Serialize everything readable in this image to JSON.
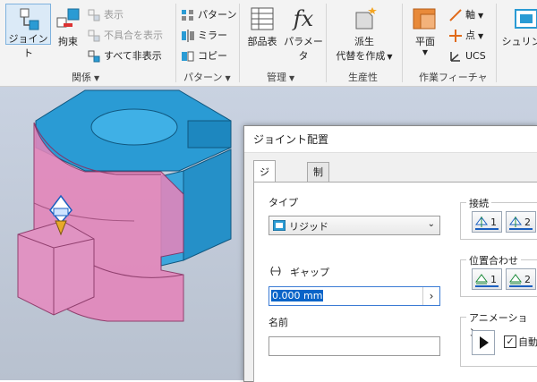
{
  "ribbon": {
    "relations": {
      "group_label": "関係",
      "joint": "ジョイント",
      "constraint": "拘束",
      "show": "表示",
      "show_sick": "不具合を表示",
      "hide_all": "すべて非表示"
    },
    "pattern": {
      "group_label": "パターン",
      "pattern": "パターン",
      "mirror": "ミラー",
      "copy": "コピー"
    },
    "manage": {
      "group_label": "管理",
      "bom": "部品表",
      "parameters": "パラメータ",
      "fx_glyph": "fx"
    },
    "productivity": {
      "group_label": "生産性",
      "derive_line1": "派生",
      "derive_line2": "代替を作成"
    },
    "work_features": {
      "group_label": "作業フィーチャ",
      "plane": "平面",
      "axis": "軸",
      "point": "点",
      "ucs": "UCS"
    },
    "shrinkwrap": {
      "label": "シュリンク"
    }
  },
  "dialog": {
    "title": "ジョイント配置",
    "tabs": [
      "ジョイント",
      "制限"
    ],
    "type_label": "タイプ",
    "type_value": "リジッド",
    "gap_label": "ギャップ",
    "gap_value": "0.000 mm",
    "name_label": "名前",
    "name_value": "",
    "connect_group": "接続",
    "connect_btn1": "1",
    "connect_btn2": "2",
    "align_group": "位置合わせ",
    "align_btn1": "1",
    "align_btn2": "2",
    "animation_group": "アニメーション",
    "animation_checkbox": "自動"
  },
  "colors": {
    "part_blue": "#2a9bd4",
    "part_pink": "#e06aa8",
    "accent": "#0a64c8"
  }
}
